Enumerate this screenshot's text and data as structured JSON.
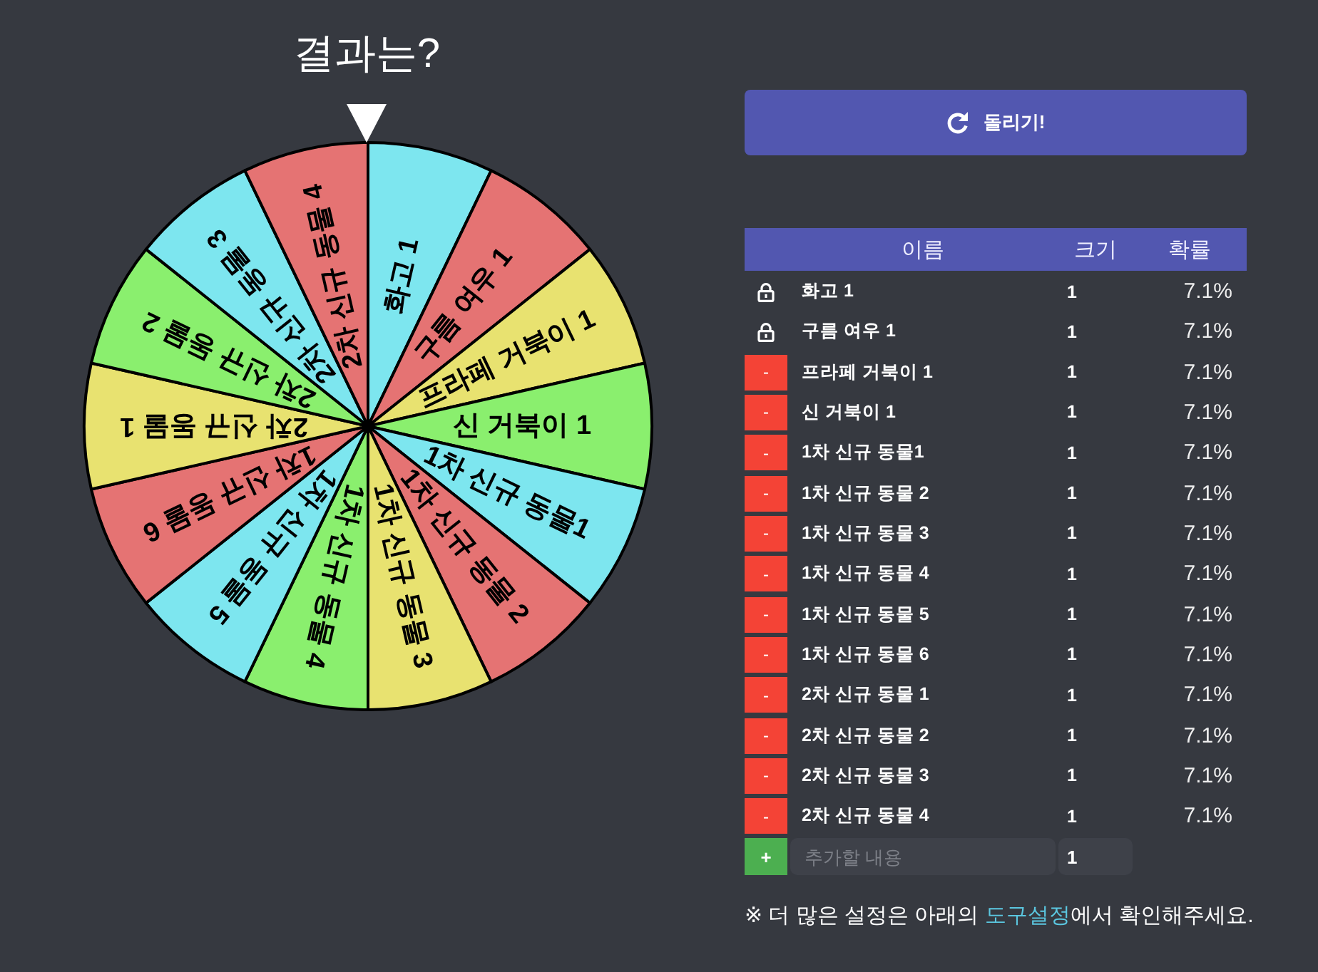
{
  "title": "결과는?",
  "wheel": {
    "segments": [
      {
        "label": "화고 1",
        "color": "#7de6ef"
      },
      {
        "label": "구름 여우 1",
        "color": "#e57373"
      },
      {
        "label": "프라페 거북이 1",
        "color": "#e8e270"
      },
      {
        "label": "신 거북이 1",
        "color": "#8aef6e"
      },
      {
        "label": "1차 신규 동물1",
        "color": "#7de6ef"
      },
      {
        "label": "1차 신규 동물 2",
        "color": "#e57373"
      },
      {
        "label": "1차 신규 동물 3",
        "color": "#e8e270"
      },
      {
        "label": "1차 신규 동물 4",
        "color": "#8aef6e"
      },
      {
        "label": "1차 신규 동물 5",
        "color": "#7de6ef"
      },
      {
        "label": "1차 신규 동물 6",
        "color": "#e57373"
      },
      {
        "label": "2차 신규 동물 1",
        "color": "#e8e270"
      },
      {
        "label": "2차 신규 동물 2",
        "color": "#8aef6e"
      },
      {
        "label": "2차 신규 동물 3",
        "color": "#7de6ef"
      },
      {
        "label": "2차 신규 동물 4",
        "color": "#e57373"
      }
    ]
  },
  "spin_button": {
    "label": "돌리기!"
  },
  "table": {
    "columns": [
      "이름",
      "크기",
      "확률"
    ],
    "rows": [
      {
        "locked": true,
        "name": "화고 1",
        "size": "1",
        "probability": "7.1%"
      },
      {
        "locked": true,
        "name": "구름 여우 1",
        "size": "1",
        "probability": "7.1%"
      },
      {
        "locked": false,
        "remove_button": "-",
        "name": "프라페 거북이 1",
        "size": "1",
        "probability": "7.1%"
      },
      {
        "locked": false,
        "remove_button": "-",
        "name": "신 거북이 1",
        "size": "1",
        "probability": "7.1%"
      },
      {
        "locked": false,
        "remove_button": "-",
        "name": "1차 신규 동물1",
        "size": "1",
        "probability": "7.1%"
      },
      {
        "locked": false,
        "remove_button": "-",
        "name": "1차 신규 동물 2",
        "size": "1",
        "probability": "7.1%"
      },
      {
        "locked": false,
        "remove_button": "-",
        "name": "1차 신규 동물 3",
        "size": "1",
        "probability": "7.1%"
      },
      {
        "locked": false,
        "remove_button": "-",
        "name": "1차 신규 동물 4",
        "size": "1",
        "probability": "7.1%"
      },
      {
        "locked": false,
        "remove_button": "-",
        "name": "1차 신규 동물 5",
        "size": "1",
        "probability": "7.1%"
      },
      {
        "locked": false,
        "remove_button": "-",
        "name": "1차 신규 동물 6",
        "size": "1",
        "probability": "7.1%"
      },
      {
        "locked": false,
        "remove_button": "-",
        "name": "2차 신규 동물 1",
        "size": "1",
        "probability": "7.1%"
      },
      {
        "locked": false,
        "remove_button": "-",
        "name": "2차 신규 동물 2",
        "size": "1",
        "probability": "7.1%"
      },
      {
        "locked": false,
        "remove_button": "-",
        "name": "2차 신규 동물 3",
        "size": "1",
        "probability": "7.1%"
      },
      {
        "locked": false,
        "remove_button": "-",
        "name": "2차 신규 동물 4",
        "size": "1",
        "probability": "7.1%"
      }
    ],
    "add_row": {
      "button": "+",
      "name_field": {
        "placeholder": "추가할 내용"
      },
      "size_field": {
        "value": "1"
      }
    }
  },
  "note": {
    "before": "※ 더 많은 설정은 아래의 ",
    "link": "도구설정",
    "after": "에서 확인해주세요."
  }
}
